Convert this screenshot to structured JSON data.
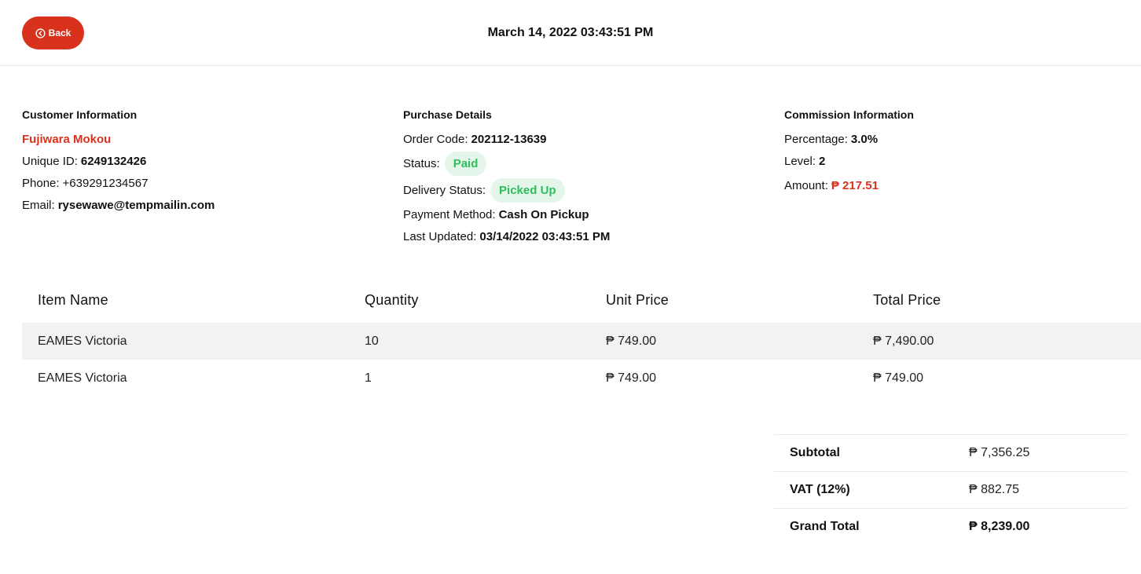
{
  "header": {
    "back_label": "Back",
    "date": "March 14, 2022 03:43:51 PM"
  },
  "customer": {
    "title": "Customer Information",
    "name": "Fujiwara Mokou",
    "unique_id_label": "Unique ID:",
    "unique_id": "6249132426",
    "phone_label": "Phone:",
    "phone": "+639291234567",
    "email_label": "Email:",
    "email": "rysewawe@tempmailin.com"
  },
  "purchase": {
    "title": "Purchase Details",
    "order_code_label": "Order Code:",
    "order_code": "202112-13639",
    "status_label": "Status:",
    "status": "Paid",
    "delivery_status_label": "Delivery Status:",
    "delivery_status": "Picked Up",
    "payment_method_label": "Payment Method:",
    "payment_method": "Cash On Pickup",
    "last_updated_label": "Last Updated:",
    "last_updated": "03/14/2022 03:43:51 PM"
  },
  "commission": {
    "title": "Commission Information",
    "percentage_label": "Percentage:",
    "percentage": "3.0%",
    "level_label": "Level:",
    "level": "2",
    "amount_label": "Amount:",
    "amount": "₱ 217.51"
  },
  "items": {
    "columns": [
      "Item Name",
      "Quantity",
      "Unit Price",
      "Total Price"
    ],
    "rows": [
      {
        "name": "EAMES Victoria",
        "quantity": "10",
        "unit_price": "₱ 749.00",
        "total_price": "₱ 7,490.00"
      },
      {
        "name": "EAMES Victoria",
        "quantity": "1",
        "unit_price": "₱ 749.00",
        "total_price": "₱ 749.00"
      }
    ]
  },
  "totals": {
    "subtotal_label": "Subtotal",
    "subtotal": "₱ 7,356.25",
    "vat_label": "VAT (12%)",
    "vat": "₱ 882.75",
    "grand_total_label": "Grand Total",
    "grand_total": "₱ 8,239.00"
  },
  "colors": {
    "accent": "#d9321c",
    "success": "#2ebd5b",
    "success_bg": "#e4f6e9"
  }
}
